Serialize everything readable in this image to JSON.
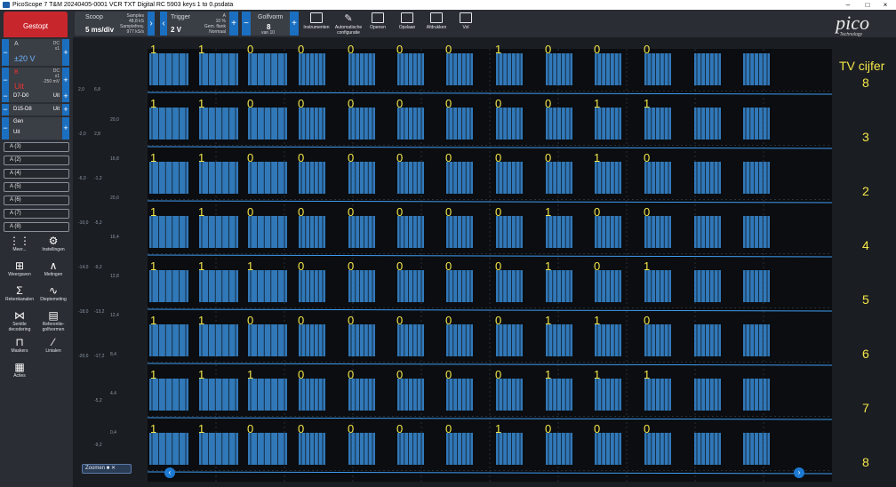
{
  "window": {
    "title": "PicoScope 7 T&M 20240405-0001 VCR TXT Digital RC 5903 keys 1 to 0.psdata",
    "min": "–",
    "max": "□",
    "close": "×"
  },
  "toolbar": {
    "stop": "Gestopt",
    "scope": {
      "label": "Scoop",
      "value": "5 ms/div",
      "samples_label": "Samples",
      "samples": "48,8 kS",
      "rate_label": "Samplefreq.",
      "rate": "977 kS/s"
    },
    "trigger": {
      "label": "Trigger",
      "value": "2 V",
      "line1": "10 %",
      "line2": "Gem. flank",
      "line3": "Normaal",
      "line4": "A"
    },
    "waveform": {
      "label": "Golfvorm",
      "value": "8",
      "of": "van 10"
    },
    "buttons": [
      "Instrumenten",
      "Automatische configuratie",
      "Openen",
      "Opslaan",
      "Afdrukken",
      "Vol"
    ],
    "logo": "pico",
    "logo_sub": "Technology"
  },
  "sidebar": {
    "chA": {
      "name": "A",
      "coupling": "DC",
      "probe": "x1",
      "range": "±20 V"
    },
    "chB": {
      "name": "B",
      "coupling": "DC",
      "probe": "x1",
      "offset": "-250 mV",
      "state": "Uit"
    },
    "digital": [
      {
        "name": "D7-D0",
        "state": "Uit"
      },
      {
        "name": "D15-D8",
        "state": "Uit"
      }
    ],
    "gen": {
      "name": "Gen",
      "state": "Uit"
    },
    "maths": [
      "A (3)",
      "A (2)",
      "A (4)",
      "A (5)",
      "A (6)",
      "A (7)",
      "A (8)"
    ],
    "tools": [
      "Meer...",
      "Instellingen",
      "Weergaven",
      "Metingen",
      "Rekenkanalen",
      "Dieptemeting",
      "Seriële decodering",
      "Referentie-golfvormen",
      "Maskers",
      "Linialen",
      "Acties"
    ]
  },
  "axes": {
    "left": [
      "2,0",
      "-2,0",
      "-6,0",
      "-10,0",
      "-14,0",
      "-18,0",
      "-20,0"
    ],
    "col2": [
      "6,8",
      "2,8",
      "-1,2",
      "-5,2",
      "-9,2",
      "-13,2",
      "-17,2",
      "-5,2",
      "-9,2"
    ],
    "col3": [
      "20,0",
      "16,8",
      "20,0",
      "16,4",
      "12,8",
      "12,4",
      "8,4",
      "4,4",
      "0,4"
    ]
  },
  "annotations": {
    "header": "TV cijfer",
    "rows": [
      {
        "digit": "8",
        "bits": [
          "1",
          "1",
          "0",
          "0",
          "0",
          "0",
          "0",
          "1",
          "0",
          "0",
          "0"
        ]
      },
      {
        "digit": "3",
        "bits": [
          "1",
          "1",
          "0",
          "0",
          "0",
          "0",
          "0",
          "0",
          "0",
          "1",
          "1"
        ]
      },
      {
        "digit": "2",
        "bits": [
          "1",
          "1",
          "0",
          "0",
          "0",
          "0",
          "0",
          "0",
          "0",
          "1",
          "0"
        ]
      },
      {
        "digit": "4",
        "bits": [
          "1",
          "1",
          "0",
          "0",
          "0",
          "0",
          "0",
          "0",
          "1",
          "0",
          "0"
        ]
      },
      {
        "digit": "5",
        "bits": [
          "1",
          "1",
          "1",
          "0",
          "0",
          "0",
          "0",
          "0",
          "1",
          "0",
          "1"
        ]
      },
      {
        "digit": "6",
        "bits": [
          "1",
          "1",
          "0",
          "0",
          "0",
          "0",
          "0",
          "0",
          "1",
          "1",
          "0"
        ]
      },
      {
        "digit": "7",
        "bits": [
          "1",
          "1",
          "1",
          "0",
          "0",
          "0",
          "0",
          "0",
          "1",
          "1",
          "1"
        ]
      },
      {
        "digit": "8",
        "bits": [
          "1",
          "1",
          "0",
          "0",
          "0",
          "0",
          "0",
          "1",
          "0",
          "0",
          "0"
        ]
      }
    ]
  },
  "zoom_label": "Zoomen",
  "colors": {
    "trace": "#3f9cf0",
    "accent": "#1b6fc0",
    "annotation": "#f5e74a",
    "stop": "#c8262d"
  }
}
